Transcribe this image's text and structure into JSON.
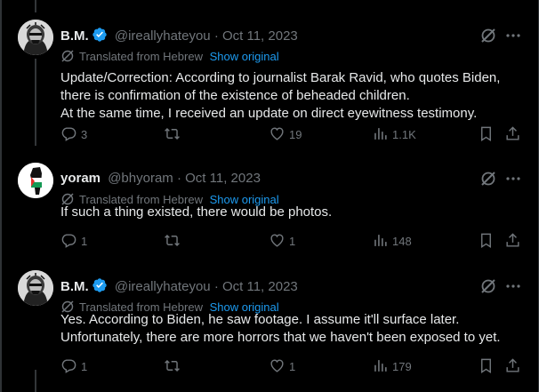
{
  "tweets": [
    {
      "name": "B.M.",
      "verified": true,
      "handle": "@ireallyhateyou",
      "date": "Oct 11, 2023",
      "translated_label": "Translated from Hebrew",
      "show_original": "Show original",
      "lines": [
        "Update/Correction: According to journalist Barak Ravid, who quotes Biden,",
        "there is confirmation of the existence of beheaded children.",
        "At the same time, I received an update on direct eyewitness testimony."
      ],
      "replies": "3",
      "retweets": "",
      "likes": "19",
      "views": "1.1K"
    },
    {
      "name": "yoram",
      "verified": false,
      "handle": "@bhyoram",
      "date": "Oct 11, 2023",
      "translated_label": "Translated from Hebrew",
      "show_original": "Show original",
      "lines": [
        "If such a thing existed, there would be photos."
      ],
      "replies": "1",
      "retweets": "",
      "likes": "1",
      "views": "148"
    },
    {
      "name": "B.M.",
      "verified": true,
      "handle": "@ireallyhateyou",
      "date": "Oct 11, 2023",
      "translated_label": "Translated from Hebrew",
      "show_original": "Show original",
      "lines": [
        "Yes. According to Biden, he saw footage. I assume it'll surface later.",
        "Unfortunately, there are more horrors that we haven't been exposed to yet."
      ],
      "replies": "1",
      "retweets": "",
      "likes": "1",
      "views": "179"
    }
  ],
  "separator": "·",
  "colors": {
    "background": "#000000",
    "text": "#e7e9ea",
    "muted": "#71767b",
    "link": "#1d9bf0",
    "verified": "#1d9bf0"
  },
  "icons": [
    "verified-badge-icon",
    "grok-icon",
    "more-icon",
    "translate-icon",
    "reply-icon",
    "retweet-icon",
    "like-icon",
    "views-icon",
    "bookmark-icon",
    "share-icon"
  ]
}
